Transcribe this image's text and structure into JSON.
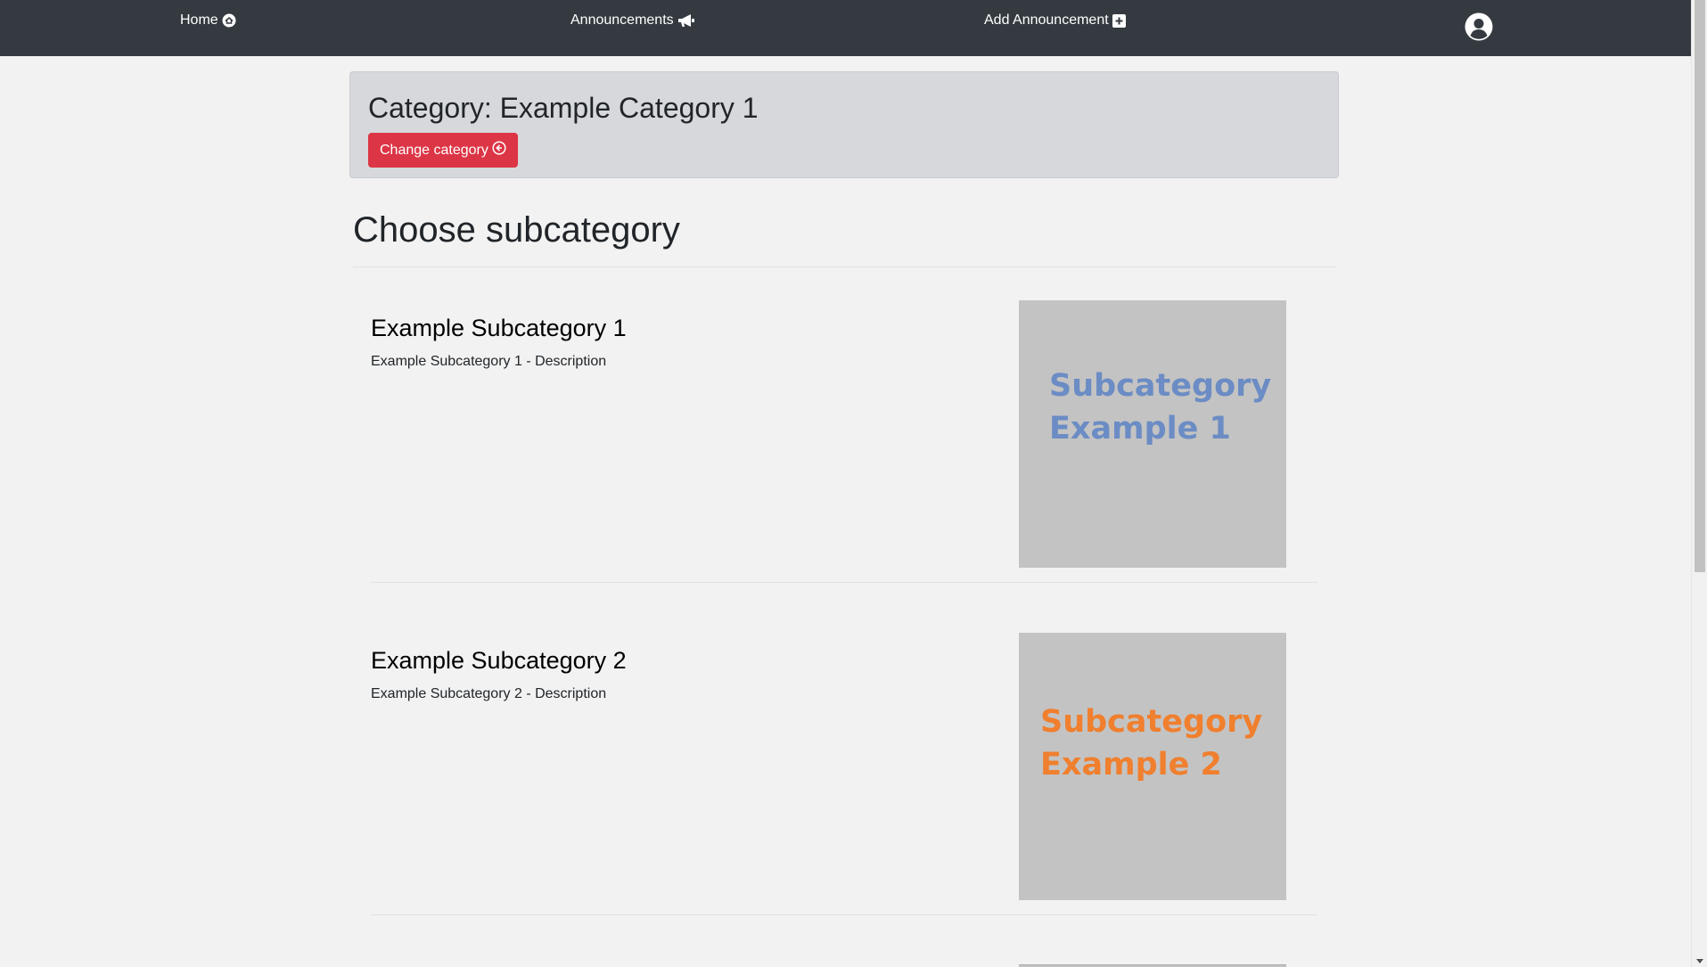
{
  "nav": {
    "home_label": "Home",
    "home_icon": "home-circle-icon",
    "announcements_label": "Announcements",
    "announcements_icon": "megaphone-icon",
    "add_label": "Add Announcement",
    "add_icon": "plus-square-icon",
    "user_icon": "user-circle-icon"
  },
  "category": {
    "title": "Category: Example Category 1",
    "change_label": "Change category",
    "change_icon": "arrow-left-circle-icon"
  },
  "section": {
    "title": "Choose subcategory"
  },
  "subcategories": [
    {
      "title": "Example Subcategory 1",
      "description": "Example Subcategory 1 - Description",
      "thumb_line1": "Subcategory",
      "thumb_line2": "Example 1",
      "thumb_color": "#6b8cc4"
    },
    {
      "title": "Example Subcategory 2",
      "description": "Example Subcategory 2 - Description",
      "thumb_line1": "Subcategory",
      "thumb_line2": "Example 2",
      "thumb_color": "#f07f2e"
    }
  ],
  "colors": {
    "navbar": "#343a40",
    "page_bg": "#f2f2f2",
    "category_bg": "#d6d8db",
    "danger": "#dc3545",
    "thumb_bg": "#c3c3c3"
  }
}
